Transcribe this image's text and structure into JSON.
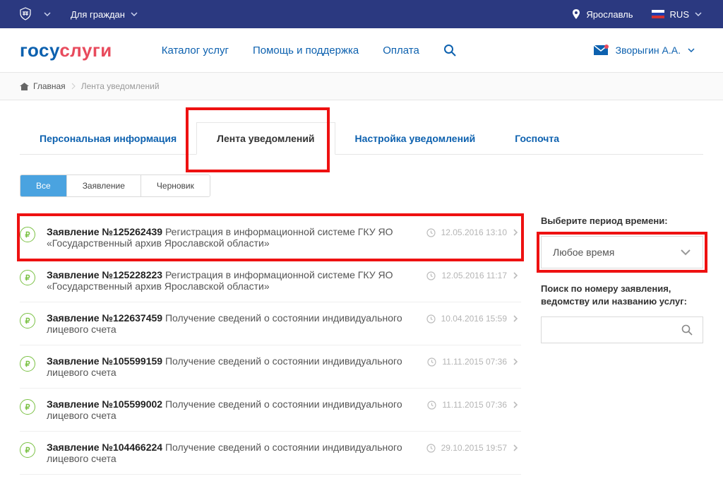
{
  "topbar": {
    "audience": "Для граждан",
    "city": "Ярославль",
    "lang": "RUS"
  },
  "logo": {
    "part1": "госу",
    "part2": "слуги"
  },
  "nav": {
    "catalog": "Каталог услуг",
    "help": "Помощь и поддержка",
    "payment": "Оплата"
  },
  "user": {
    "name": "Зворыгин А.А."
  },
  "breadcrumb": {
    "home": "Главная",
    "current": "Лента уведомлений"
  },
  "tabs": {
    "personal": "Персональная информация",
    "feed": "Лента уведомлений",
    "settings": "Настройка уведомлений",
    "gospochta": "Госпочта"
  },
  "filters": {
    "all": "Все",
    "application": "Заявление",
    "draft": "Черновик"
  },
  "items": [
    {
      "title": "Заявление №125262439",
      "desc": "Регистрация в информационной системе ГКУ ЯО «Государственный архив Ярославской области»",
      "date": "12.05.2016 13:10",
      "highlighted": true
    },
    {
      "title": "Заявление №125228223",
      "desc": "Регистрация в информационной системе ГКУ ЯО «Государственный архив Ярославской области»",
      "date": "12.05.2016 11:17"
    },
    {
      "title": "Заявление №122637459",
      "desc": "Получение сведений о состоянии индивидуального лицевого счета",
      "date": "10.04.2016 15:59"
    },
    {
      "title": "Заявление №105599159",
      "desc": "Получение сведений о состоянии индивидуального лицевого счета",
      "date": "11.11.2015 07:36"
    },
    {
      "title": "Заявление №105599002",
      "desc": "Получение сведений о состоянии индивидуального лицевого счета",
      "date": "11.11.2015 07:36"
    },
    {
      "title": "Заявление №104466224",
      "desc": "Получение сведений о состоянии индивидуального лицевого счета",
      "date": "29.10.2015 19:57"
    }
  ],
  "sidebar": {
    "period_label": "Выберите период времени:",
    "period_value": "Любое время",
    "search_label": "Поиск по номеру заявления, ведомству или названию услуг:"
  },
  "ruble_sign": "₽"
}
